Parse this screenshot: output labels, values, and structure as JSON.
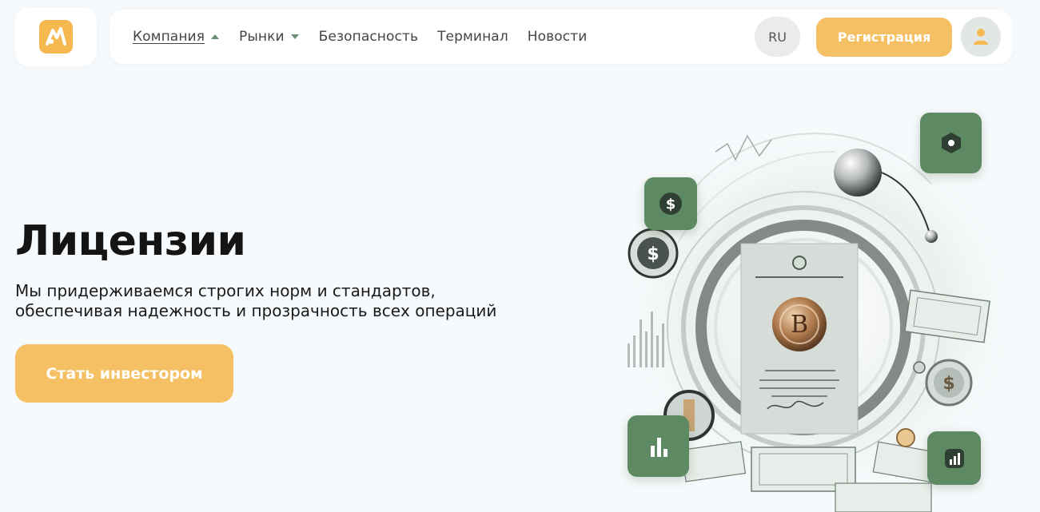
{
  "header": {
    "nav": [
      {
        "label": "Компания",
        "active": true,
        "caret": "up"
      },
      {
        "label": "Рынки",
        "active": false,
        "caret": "down"
      },
      {
        "label": "Безопасность",
        "active": false
      },
      {
        "label": "Терминал",
        "active": false
      },
      {
        "label": "Новости",
        "active": false
      }
    ],
    "lang": "RU",
    "register_label": "Регистрация"
  },
  "hero": {
    "title": "Лицензии",
    "subtitle_line1": "Мы придерживаемся строгих норм и стандартов,",
    "subtitle_line2": "обеспечивая надежность и прозрачность всех операций",
    "cta_label": "Стать инвестором"
  },
  "illustration": {
    "coin_symbol": "$",
    "seal_letter": "B"
  },
  "colors": {
    "accent": "#f5c063",
    "tile_green": "#5d8a62",
    "background": "#f7fafc"
  },
  "icons": [
    "logo-icon",
    "caret-up-icon",
    "caret-down-icon",
    "user-icon",
    "dollar-icon",
    "hexagon-icon",
    "bar-chart-icon",
    "chart-icon"
  ]
}
